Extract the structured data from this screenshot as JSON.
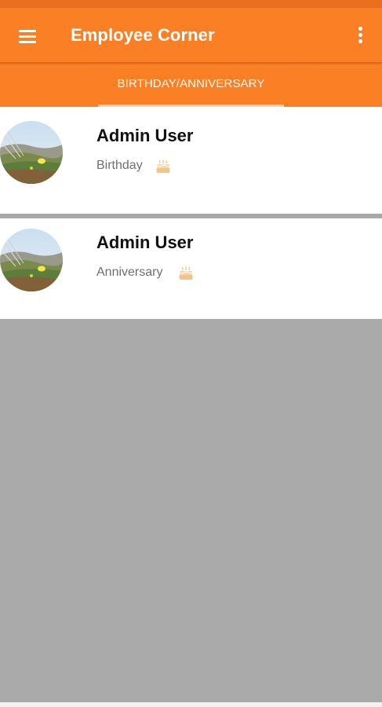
{
  "appbar": {
    "title": "Employee Corner",
    "menu_icon": "hamburger-menu-icon",
    "overflow_icon": "more-vertical-icon",
    "color": "#fb7f24"
  },
  "tabs": [
    {
      "label": "BIRTHDAY/ANNIVERSARY",
      "selected": true
    }
  ],
  "events": [
    {
      "name": "Admin User",
      "event": "Birthday",
      "icon": "birthday-cake-icon"
    },
    {
      "name": "Admin User",
      "event": "Anniversary",
      "icon": "birthday-cake-icon"
    }
  ]
}
